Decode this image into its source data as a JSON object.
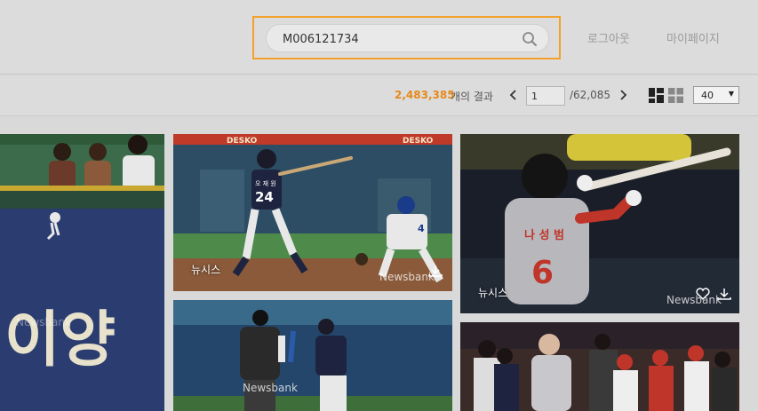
{
  "header": {
    "search": {
      "value": "M006121734",
      "placeholder": ""
    },
    "nav": {
      "logout": "로그아웃",
      "mypage": "마이페이지"
    }
  },
  "toolbar": {
    "result_count": "2,483,385",
    "result_label": "개의 결과",
    "page_current": "1",
    "page_total": "/62,085",
    "per_page": "40"
  },
  "photos": [
    {
      "caption": "",
      "watermark": "Newsbank"
    },
    {
      "caption": "뉴시스",
      "watermark": "Newsbank"
    },
    {
      "caption": "뉴시스",
      "watermark": "Newsbank"
    },
    {
      "caption": "",
      "watermark": "Newsbank"
    },
    {
      "caption": "",
      "watermark": ""
    }
  ],
  "scene_text": {
    "banner_left": "DESKO",
    "banner_right": "DESKO",
    "jersey_1": "24",
    "jersey_1_name": "오 재 원",
    "jersey_2": "4",
    "jersey_3": "6",
    "jersey_3_name": "나 성 범",
    "stadium_sign": "이양",
    "watermark_faint": "Newsbank"
  },
  "colors": {
    "accent": "#f5a02a",
    "count": "#e6891a"
  }
}
